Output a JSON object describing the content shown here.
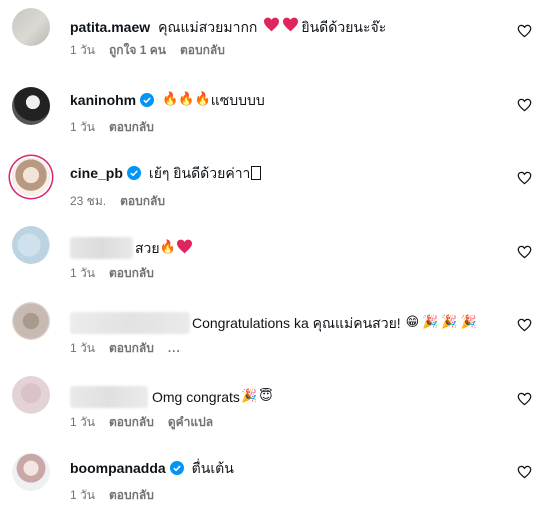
{
  "icons": {
    "like": "heart-outline-icon",
    "verified": "verified-badge-icon",
    "more": "more-horizontal-icon"
  },
  "colors": {
    "verified": "#0095f6",
    "text": "#0f1419",
    "meta": "#737373",
    "heart": "#e0245e",
    "story_ring": "#d62976"
  },
  "comments": [
    {
      "username": "patita.maew",
      "verified": false,
      "text": "คุณแม่สวยมากก",
      "emojis": [
        "❤️",
        "❤️"
      ],
      "text_after": "ยินดีด้วยนะจ๊ะ",
      "time": "1 วัน",
      "likes": "ถูกใจ 1 คน",
      "reply": "ตอบกลับ"
    },
    {
      "username": "kaninohm",
      "verified": true,
      "text": "",
      "emojis": [
        "🔥",
        "🔥",
        "🔥"
      ],
      "text_after": "แซบบบบ",
      "time": "1 วัน",
      "reply": "ตอบกลับ"
    },
    {
      "username": "cine_pb",
      "verified": true,
      "text": "เย้ๆ ยินดีด้วยค่าา",
      "emojis": [],
      "text_after": "",
      "time": "23 ชม.",
      "reply": "ตอบกลับ"
    },
    {
      "username": "",
      "verified": false,
      "text": "สวย",
      "emojis": [
        "🔥",
        "❤️"
      ],
      "text_after": "",
      "time": "1 วัน",
      "reply": "ตอบกลับ"
    },
    {
      "username": "",
      "verified": false,
      "text": "Congratulations ka คุณแม่คนสวย!",
      "emojis": [
        "😁",
        "🎉",
        "🎉",
        "🎉"
      ],
      "text_after": "",
      "time": "1 วัน",
      "reply": "ตอบกลับ",
      "more": "..."
    },
    {
      "username": "",
      "verified": false,
      "text": "Omg congrats",
      "emojis": [
        "🎉",
        "😇"
      ],
      "text_after": "",
      "time": "1 วัน",
      "reply": "ตอบกลับ",
      "translate": "ดูคำแปล"
    },
    {
      "username": "boompanadda",
      "verified": true,
      "text": "ตื่นเต้น",
      "emojis": [],
      "text_after": "",
      "time": "1 วัน",
      "reply": "ตอบกลับ"
    }
  ]
}
